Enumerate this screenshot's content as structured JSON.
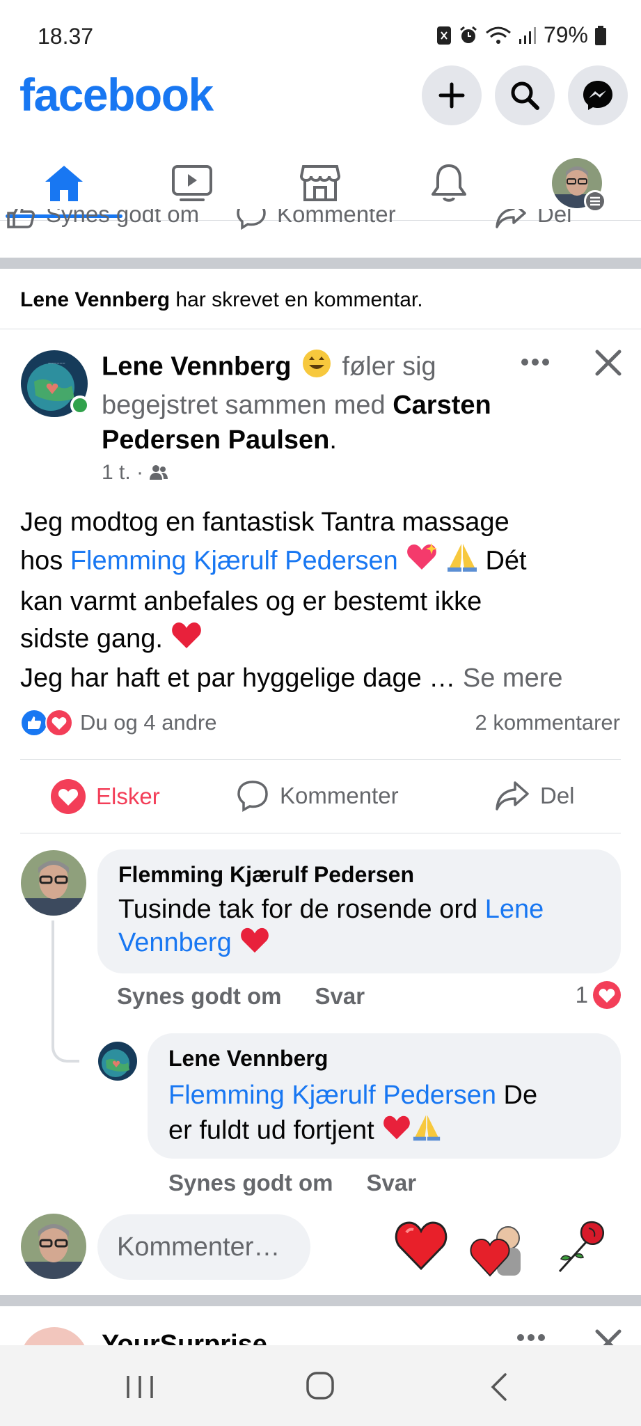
{
  "status_bar": {
    "time": "18.37",
    "battery": "79%"
  },
  "header": {
    "logo": "facebook",
    "icons": [
      "plus-icon",
      "search-icon",
      "messenger-icon"
    ]
  },
  "nav": {
    "tabs": [
      "home",
      "watch",
      "marketplace",
      "notifications",
      "profile"
    ]
  },
  "prev_post_actions": {
    "like": "Synes godt om",
    "comment": "Kommenter",
    "share": "Del"
  },
  "activity": {
    "name": "Lene Vennberg",
    "text": "har skrevet en kommentar."
  },
  "post": {
    "author": "Lene Vennberg",
    "feeling_text": "føler sig begejstret sammen med",
    "tagged": "Carsten Pedersen Paulsen",
    "period": ".",
    "time": "1 t. ·",
    "body_line1": "Jeg modtog en fantastisk Tantra massage",
    "body_hos": "hos ",
    "body_mention": "Flemming Kjærulf Pedersen",
    "body_after_mention": " Dét",
    "body_line3": "kan varmt anbefales og er bestemt ikke",
    "body_line4": "sidste gang.",
    "body_line5": "Jeg har haft et par hyggelige dage …",
    "see_more": "Se mere",
    "reactions_text": "Du og 4 andre",
    "comments_count": "2 kommentarer"
  },
  "post_actions": {
    "love": "Elsker",
    "comment": "Kommenter",
    "share": "Del"
  },
  "comments": [
    {
      "author": "Flemming Kjærulf Pedersen",
      "text": "Tusinde tak for de rosende ord ",
      "mention": "Lene Vennberg",
      "like": "Synes godt om",
      "reply": "Svar",
      "reaction_count": "1"
    },
    {
      "author": "Lene Vennberg",
      "mention": "Flemming Kjærulf Pedersen",
      "text_after": " De",
      "text_line2": "er fuldt ud fortjent",
      "like": "Synes godt om",
      "reply": "Svar"
    }
  ],
  "composer": {
    "placeholder": "Kommenter…"
  },
  "next_post": {
    "author": "YourSurprise"
  },
  "colors": {
    "brand": "#1877f2",
    "love": "#f33e58",
    "secondary_text": "#65676b"
  }
}
